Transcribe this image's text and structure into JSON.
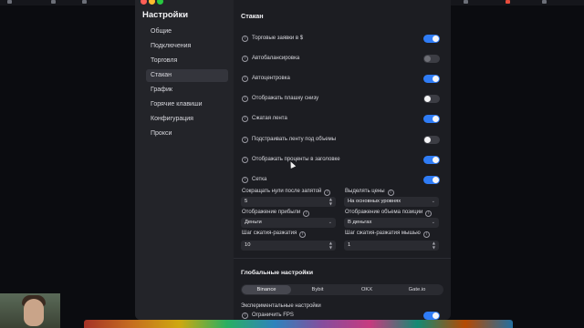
{
  "sidebar": {
    "title": "Настройки",
    "items": [
      {
        "label": "Общие"
      },
      {
        "label": "Подключения"
      },
      {
        "label": "Торговля"
      },
      {
        "label": "Стакан"
      },
      {
        "label": "График"
      },
      {
        "label": "Горячие клавиши"
      },
      {
        "label": "Конфигурация"
      },
      {
        "label": "Прокси"
      }
    ],
    "active": "Стакан"
  },
  "main": {
    "title": "Стакан",
    "info_glyph": "i",
    "toggles": [
      {
        "label": "Торговые заявки в $",
        "on": true
      },
      {
        "label": "Автобалансировка",
        "on": false,
        "disabled": true
      },
      {
        "label": "Автоцентровка",
        "on": true
      },
      {
        "label": "Отображать плашку снизу",
        "on": false
      },
      {
        "label": "Сжатая лента",
        "on": true
      },
      {
        "label": "Подстраивать ленту под объемы",
        "on": false
      },
      {
        "label": "Отображать проценты в заголовке",
        "on": true
      },
      {
        "label": "Сетка",
        "on": true
      }
    ],
    "fields": [
      {
        "label": "Сокращать нули после запятой",
        "value": "5",
        "kind": "stepper"
      },
      {
        "label": "Выделять цены",
        "value": "На основных уровнях",
        "kind": "select"
      },
      {
        "label": "Отображение прибыли",
        "value": "Деньги",
        "kind": "select"
      },
      {
        "label": "Отображение объема позиции",
        "value": "В деньгах",
        "kind": "select"
      },
      {
        "label": "Шаг сжатия-разжатия",
        "value": "10",
        "kind": "stepper"
      },
      {
        "label": "Шаг сжатия-разжатия мышью",
        "value": "1",
        "kind": "stepper"
      }
    ]
  },
  "global": {
    "title": "Глобальные настройки",
    "exchanges": [
      "Binance",
      "Bybit",
      "OKX",
      "Gate.io"
    ],
    "selected_exchange": "Binance",
    "experimental_title": "Экспериментальные настройки",
    "limit_fps": {
      "label": "Ограничить FPS",
      "on": true
    }
  },
  "colors": {
    "accent": "#2f7cf6",
    "window_bg": "#1c1d22",
    "sidebar_bg": "#232429"
  }
}
